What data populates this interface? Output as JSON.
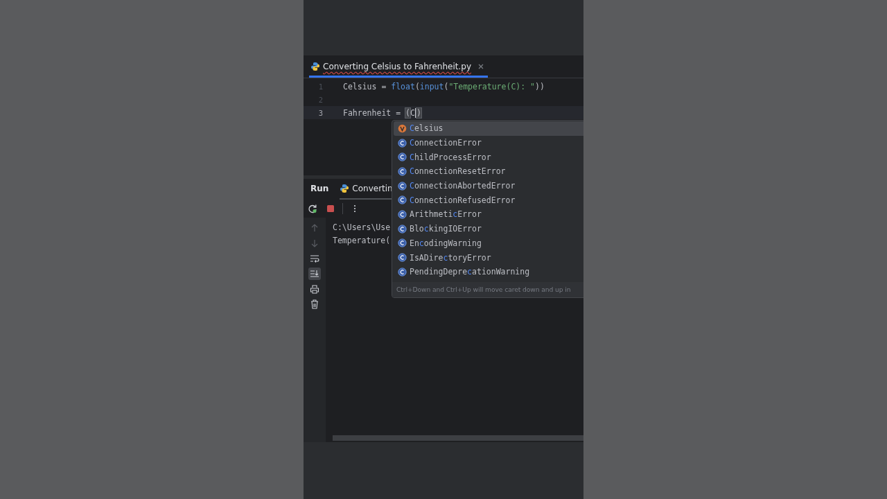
{
  "editor_tab": {
    "title": "Converting Celsius to Fahrenheit.py",
    "selected": true
  },
  "lines": [
    {
      "number": "1",
      "current": false,
      "tokens": [
        {
          "kind": "plain",
          "text": "Celsius = "
        },
        {
          "kind": "builtin",
          "text": "float"
        },
        {
          "kind": "plain",
          "text": "("
        },
        {
          "kind": "builtin",
          "text": "input"
        },
        {
          "kind": "plain",
          "text": "("
        },
        {
          "kind": "string",
          "text": "\"Temperature(C): \""
        },
        {
          "kind": "plain",
          "text": "))"
        }
      ]
    },
    {
      "number": "2",
      "current": false
    },
    {
      "number": "3",
      "current": true,
      "tokens": [
        {
          "kind": "plain",
          "text": "Fahrenheit = "
        },
        {
          "kind": "bracket",
          "text": "("
        },
        {
          "kind": "plain",
          "text": "C"
        },
        {
          "kind": "caret"
        },
        {
          "kind": "bracket",
          "text": ")"
        }
      ]
    }
  ],
  "completion": {
    "items": [
      {
        "kind": "variable",
        "selected": true,
        "hit": "C",
        "post": "elsius"
      },
      {
        "kind": "class",
        "selected": false,
        "hit": "C",
        "post": "onnectionError"
      },
      {
        "kind": "class",
        "selected": false,
        "hit": "C",
        "post": "hildProcessError"
      },
      {
        "kind": "class",
        "selected": false,
        "hit": "C",
        "post": "onnectionResetError"
      },
      {
        "kind": "class",
        "selected": false,
        "hit": "C",
        "post": "onnectionAbortedError"
      },
      {
        "kind": "class",
        "selected": false,
        "hit": "C",
        "post": "onnectionRefusedError"
      },
      {
        "kind": "class",
        "selected": false,
        "pre": "Arithmeti",
        "hit": "c",
        "post": "Error"
      },
      {
        "kind": "class",
        "selected": false,
        "pre": "Blo",
        "hit": "c",
        "post": "kingIOError"
      },
      {
        "kind": "class",
        "selected": false,
        "pre": "En",
        "hit": "c",
        "post": "odingWarning"
      },
      {
        "kind": "class",
        "selected": false,
        "pre": "IsADire",
        "hit": "c",
        "post": "toryError"
      },
      {
        "kind": "class",
        "selected": false,
        "pre": "PendingDepre",
        "hit": "c",
        "post": "ationWarning"
      }
    ],
    "hint": "Ctrl+Down and Ctrl+Up will move caret down and up in"
  },
  "run_panel": {
    "title": "Run",
    "tab": "Convertin",
    "console": [
      "C:\\Users\\Use",
      "Temperature("
    ]
  }
}
